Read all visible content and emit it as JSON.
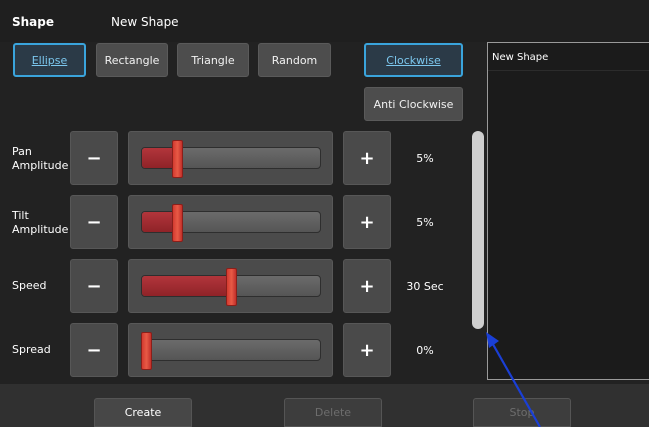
{
  "header": {
    "title": "Shape",
    "shape_name": "New Shape"
  },
  "shape_types": [
    {
      "label": "Ellipse",
      "selected": true
    },
    {
      "label": "Rectangle",
      "selected": false
    },
    {
      "label": "Triangle",
      "selected": false
    },
    {
      "label": "Random",
      "selected": false
    }
  ],
  "direction": {
    "clockwise": {
      "label": "Clockwise",
      "selected": true
    },
    "anticlockwise": {
      "label": "Anti Clockwise",
      "selected": false
    }
  },
  "controls": [
    {
      "label_line1": "Pan",
      "label_line2": "Amplitude",
      "value": "5%",
      "level": 0.2,
      "minus": "−",
      "plus": "+"
    },
    {
      "label_line1": "Tilt",
      "label_line2": "Amplitude",
      "value": "5%",
      "level": 0.2,
      "minus": "−",
      "plus": "+"
    },
    {
      "label_line1": "Speed",
      "label_line2": "",
      "value": "30 Sec",
      "level": 0.5,
      "minus": "−",
      "plus": "+"
    },
    {
      "label_line1": "Spread",
      "label_line2": "",
      "value": "0%",
      "level": 0.0,
      "minus": "−",
      "plus": "+"
    }
  ],
  "shape_list": {
    "items": [
      "New Shape"
    ]
  },
  "footer": {
    "create": "Create",
    "delete": "Delete",
    "stop": "Stop"
  },
  "colors": {
    "accent": "#3aa4dc",
    "slider_fill": "#a82c32",
    "slider_thumb": "#e0493a",
    "annotation_arrow": "#1a3fd6"
  }
}
